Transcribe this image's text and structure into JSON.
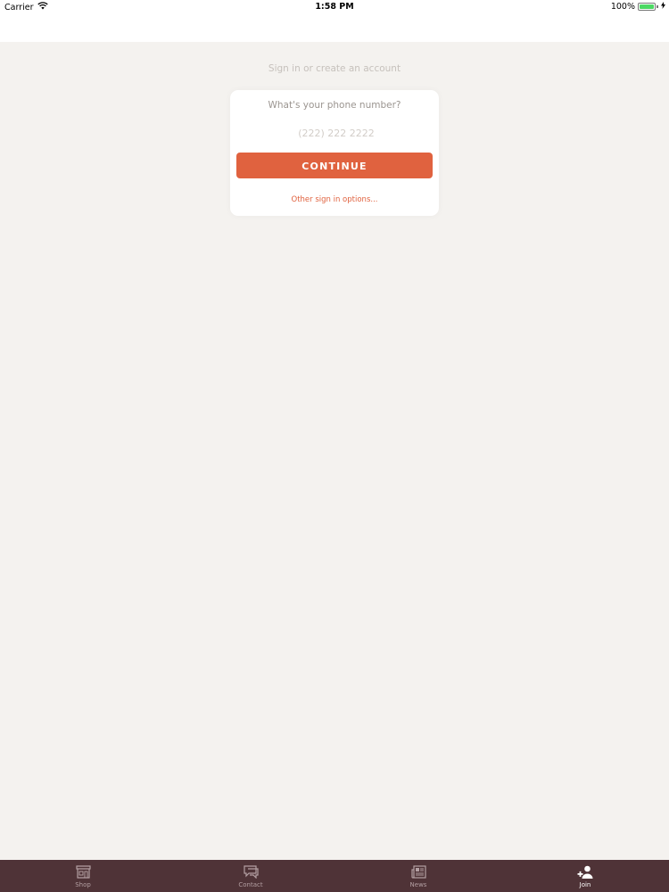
{
  "status_bar": {
    "carrier": "Carrier",
    "time": "1:58 PM",
    "battery_percent": "100%",
    "battery_level": 1.0
  },
  "login": {
    "heading": "Sign in or create an account",
    "phone_label": "What's your phone number?",
    "phone_placeholder": "(222) 222 2222",
    "continue_label": "CONTINUE",
    "other_options_label": "Other sign in options..."
  },
  "tabs": [
    {
      "label": "Shop",
      "icon": "storefront-icon",
      "active": false
    },
    {
      "label": "Contact",
      "icon": "chat-bubble-icon",
      "active": false
    },
    {
      "label": "News",
      "icon": "newspaper-icon",
      "active": false
    },
    {
      "label": "Join",
      "icon": "add-user-icon",
      "active": true
    }
  ],
  "colors": {
    "accent": "#e0623f",
    "background": "#f4f2ef",
    "tab_bar": "#4f3337"
  }
}
